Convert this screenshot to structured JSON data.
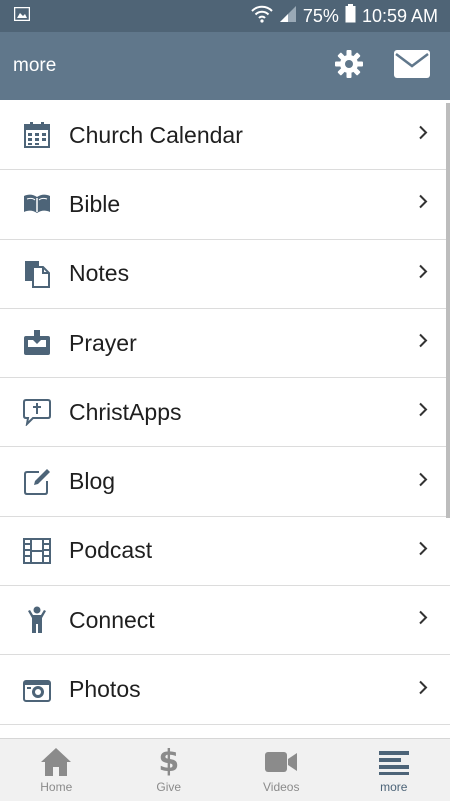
{
  "status_bar": {
    "battery_percent": "75%",
    "time": "10:59 AM",
    "icons": [
      "gallery-icon",
      "wifi-icon",
      "signal-icon",
      "battery-icon"
    ]
  },
  "app_bar": {
    "title": "more",
    "actions": [
      "gear-icon",
      "mail-icon"
    ]
  },
  "menu": {
    "items": [
      {
        "label": "Church Calendar",
        "icon": "calendar-icon"
      },
      {
        "label": "Bible",
        "icon": "book-icon"
      },
      {
        "label": "Notes",
        "icon": "notes-icon"
      },
      {
        "label": "Prayer",
        "icon": "inbox-icon"
      },
      {
        "label": "ChristApps",
        "icon": "chat-cross-icon"
      },
      {
        "label": "Blog",
        "icon": "edit-icon"
      },
      {
        "label": "Podcast",
        "icon": "film-icon"
      },
      {
        "label": "Connect",
        "icon": "person-icon"
      },
      {
        "label": "Photos",
        "icon": "camera-icon"
      }
    ]
  },
  "bottom_nav": {
    "tabs": [
      {
        "label": "Home",
        "icon": "home-icon",
        "active": false
      },
      {
        "label": "Give",
        "icon": "dollar-icon",
        "active": false
      },
      {
        "label": "Videos",
        "icon": "video-camera-icon",
        "active": false
      },
      {
        "label": "more",
        "icon": "menu-lines-icon",
        "active": true
      }
    ]
  },
  "colors": {
    "status_bar_bg": "#4f6476",
    "app_bar_bg": "#60778b",
    "icon_color": "#4d6478",
    "active_tab": "#4d6478",
    "inactive_tab": "#8b8b8b"
  }
}
